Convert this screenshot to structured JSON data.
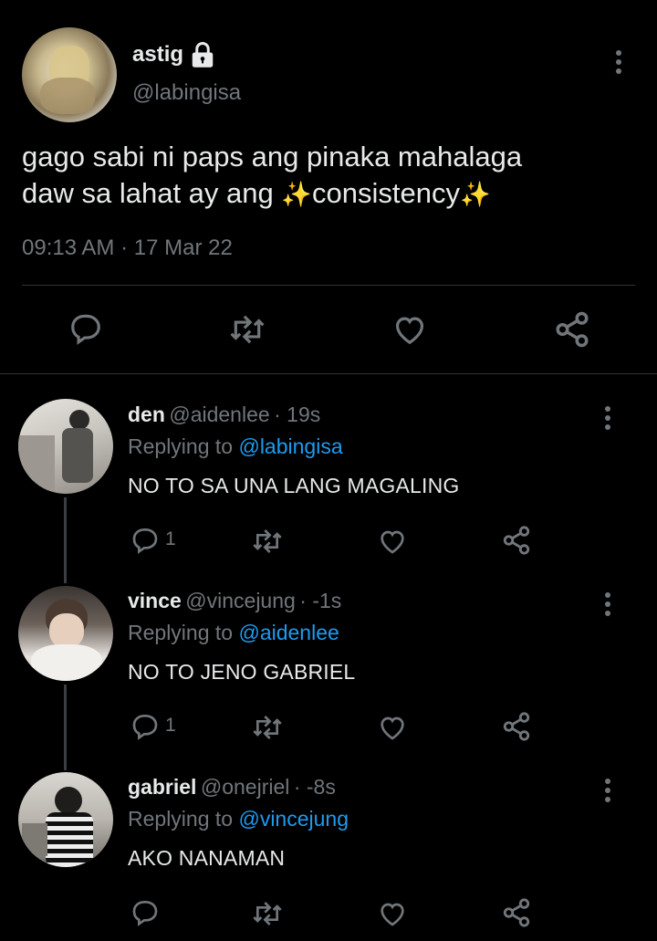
{
  "main_tweet": {
    "display_name": "astig",
    "handle": "@labingisa",
    "text_line1": "gago sabi ni paps ang pinaka mahalaga",
    "text_line2a": "daw sa lahat ay ang ",
    "text_line2b": "consistency",
    "sparkle": "✨",
    "time": "09:13 AM",
    "separator": "·",
    "date": "17 Mar 22"
  },
  "replies": [
    {
      "display_name": "den",
      "handle": "@aidenlee",
      "time": "· 19s",
      "replying_prefix": "Replying to",
      "replying_to": "@labingisa",
      "text": "NO TO SA UNA LANG MAGALING",
      "reply_count": "1"
    },
    {
      "display_name": "vince",
      "handle": "@vincejung",
      "time": "· -1s",
      "replying_prefix": "Replying to",
      "replying_to": "@aidenlee",
      "text": "NO TO JENO GABRIEL",
      "reply_count": "1"
    },
    {
      "display_name": "gabriel",
      "handle": "@onejriel",
      "time": "· -8s",
      "replying_prefix": "Replying to",
      "replying_to": "@vincejung",
      "text": "AKO NANAMAN",
      "reply_count": ""
    }
  ],
  "icons": {
    "reply": "reply-icon",
    "retweet": "retweet-icon",
    "like": "heart-icon",
    "share": "share-icon",
    "more": "more-options-icon",
    "lock": "lock-icon"
  },
  "colors": {
    "background": "#000000",
    "text": "#e7e9ea",
    "muted": "#71767b",
    "link": "#1d9bf0",
    "divider": "#2f3336"
  }
}
